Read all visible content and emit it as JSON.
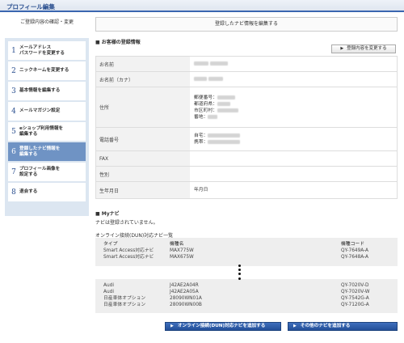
{
  "header": {
    "title": "プロフィール編集"
  },
  "sidebar": {
    "heading": "ご登録内容の確認・変更",
    "items": [
      {
        "num": "1",
        "label1": "メールアドレス",
        "label2": "パスワードを変更する"
      },
      {
        "num": "2",
        "label1": "ニックネームを変更する",
        "label2": ""
      },
      {
        "num": "3",
        "label1": "基本情報を編集する",
        "label2": ""
      },
      {
        "num": "4",
        "label1": "メールマガジン設定",
        "label2": ""
      },
      {
        "num": "5",
        "label1": "eショップ利用情報を",
        "label2": "編集する"
      },
      {
        "num": "6",
        "label1": "登録したナビ情報を",
        "label2": "編集する"
      },
      {
        "num": "7",
        "label1": "プロフィール画像を",
        "label2": "設定する"
      },
      {
        "num": "8",
        "label1": "退会する",
        "label2": ""
      }
    ]
  },
  "main": {
    "tab_label": "登録したナビ情報を編集する",
    "customer_section": "■ お客様の登録情報",
    "edit_button": "登録内容を変更する",
    "rows": {
      "name": "お名前",
      "name_kana": "お名前（カナ）",
      "address": "住所",
      "address_lines": [
        "郵便番号：",
        "都道府県：",
        "市区町村：",
        "番地："
      ],
      "phone": "電話番号",
      "phone_lines": [
        "自宅：",
        "携帯："
      ],
      "fax": "FAX",
      "gender": "性別",
      "birthdate": "生年月日",
      "birthdate_value": "年月日"
    },
    "mynavi": {
      "heading": "■ Myナビ",
      "status": "ナビは登録されていません。",
      "online_label": "オンライン接続(DUN)対応ナビ一覧"
    },
    "list": {
      "headers": {
        "type": "タイプ",
        "model": "機種名",
        "code": "機種コード"
      },
      "top_rows": [
        {
          "type": "Smart Access対応ナビ",
          "model": "MAX775W",
          "code": "QY-7649A-A"
        },
        {
          "type": "Smart Access対応ナビ",
          "model": "MAX675W",
          "code": "QY-7648A-A"
        }
      ],
      "bottom_rows": [
        {
          "type": "Audi",
          "model": "J42AE2A04R",
          "code": "QY-7020V-D"
        },
        {
          "type": "Audi",
          "model": "J42AE2A05A",
          "code": "QY-7020V-W"
        },
        {
          "type": "日産車体オプション",
          "model": "28090WN01A",
          "code": "QY-7542G-A"
        },
        {
          "type": "日産車体オプション",
          "model": "28090WN00B",
          "code": "QY-7120G-A"
        }
      ]
    },
    "buttons": {
      "add_online": "オンライン接続(DUN)対応ナビを追加する",
      "add_other": "その他のナビを追加する"
    }
  },
  "colors": {
    "accent": "#3a66b0",
    "active_nav": "#6f93c4",
    "sidebar_bg": "#dce6f1",
    "button": "#2d5aa5"
  }
}
